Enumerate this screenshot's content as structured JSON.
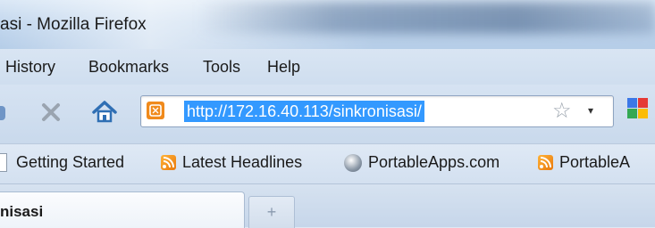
{
  "window": {
    "title": "asi - Mozilla Firefox"
  },
  "menu": {
    "items": [
      "History",
      "Bookmarks",
      "Tools",
      "Help"
    ]
  },
  "navigation": {
    "url": "http://172.16.40.113/sinkronisasi/",
    "icons": [
      "stop-icon",
      "home-icon",
      "site-icon",
      "bookmark-star-icon",
      "history-dropmarker-icon",
      "search-engine-icon"
    ]
  },
  "bookmarks_toolbar": {
    "items": [
      {
        "label": "Getting Started",
        "icon": "page-icon"
      },
      {
        "label": "Latest Headlines",
        "icon": "rss-feed-icon"
      },
      {
        "label": "PortableApps.com",
        "icon": "portableapps-icon"
      },
      {
        "label": "PortableA",
        "icon": "rss-feed-icon"
      }
    ]
  },
  "tabs": {
    "active_label": "nisasi",
    "new_tab_symbol": "+"
  },
  "colors": {
    "selection": "#3399ff",
    "site_icon": "#f08a1c",
    "rss": "#f39a1e"
  }
}
